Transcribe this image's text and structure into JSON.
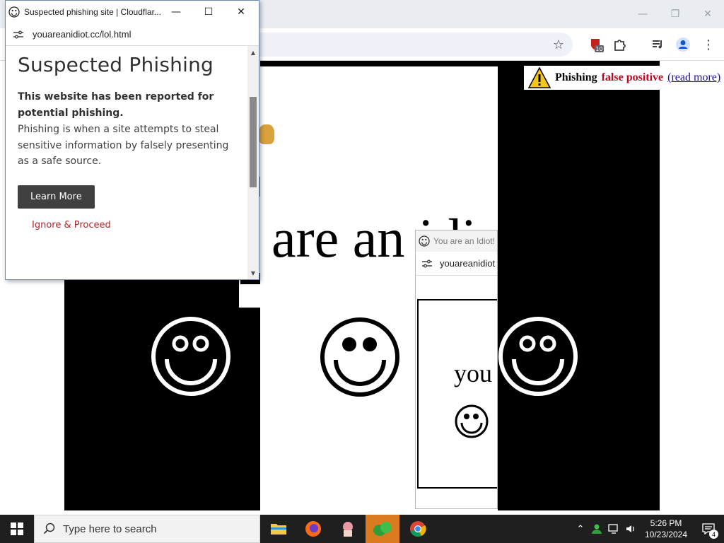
{
  "chrome": {
    "minimize": "—",
    "restore": "❐",
    "close": "✕",
    "extension_badge": "10"
  },
  "page": {
    "banner": {
      "word1": "Phishing",
      "word2": "false positive",
      "link": "(read more)"
    },
    "big_text": "are an idiot",
    "partial_text": "you"
  },
  "idiot_popup": {
    "title": "You are an Idiot!",
    "url": "youareanidiot"
  },
  "phish_popup": {
    "title": "Suspected phishing site | Cloudflar...",
    "url": "youareanidiot.cc/lol.html",
    "heading": "Suspected Phishing",
    "strong_text": "This website has been reported for potential phishing.",
    "paragraph": "Phishing is when a site attempts to steal sensitive information by falsely presenting as a safe source.",
    "learn_more": "Learn More",
    "ignore": "Ignore & Proceed"
  },
  "taskbar": {
    "search_placeholder": "Type here to search",
    "time": "5:26 PM",
    "date": "10/23/2024",
    "notification_count": "4"
  },
  "colors": {
    "accent_active": "#d97b1e",
    "banner_red": "#c8001e",
    "link_blue": "#1a0dab"
  }
}
